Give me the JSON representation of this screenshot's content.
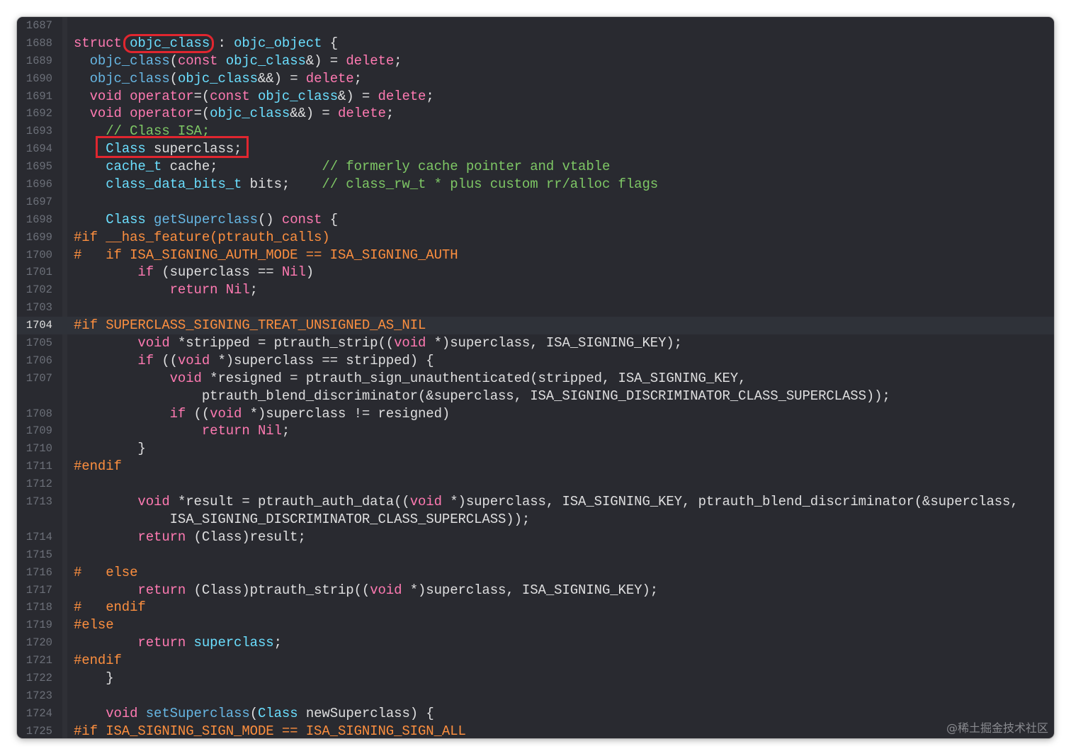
{
  "editor": {
    "lines": [
      {
        "n": "1687",
        "t": []
      },
      {
        "n": "1688",
        "t": [
          [
            "kw",
            "struct"
          ],
          [
            "id",
            " "
          ],
          [
            "type",
            "objc_class"
          ],
          [
            "id",
            " : "
          ],
          [
            "type",
            "objc_object"
          ],
          [
            "id",
            " {"
          ]
        ]
      },
      {
        "n": "1689",
        "t": [
          [
            "id",
            "  "
          ],
          [
            "fn",
            "objc_class"
          ],
          [
            "id",
            "("
          ],
          [
            "kw",
            "const"
          ],
          [
            "id",
            " "
          ],
          [
            "type",
            "objc_class"
          ],
          [
            "id",
            "&) = "
          ],
          [
            "kw",
            "delete"
          ],
          [
            "id",
            ";"
          ]
        ]
      },
      {
        "n": "1690",
        "t": [
          [
            "id",
            "  "
          ],
          [
            "fn",
            "objc_class"
          ],
          [
            "id",
            "("
          ],
          [
            "type",
            "objc_class"
          ],
          [
            "id",
            "&&) = "
          ],
          [
            "kw",
            "delete"
          ],
          [
            "id",
            ";"
          ]
        ]
      },
      {
        "n": "1691",
        "t": [
          [
            "id",
            "  "
          ],
          [
            "kw",
            "void"
          ],
          [
            "id",
            " "
          ],
          [
            "kw",
            "operator"
          ],
          [
            "id",
            "=("
          ],
          [
            "kw",
            "const"
          ],
          [
            "id",
            " "
          ],
          [
            "type",
            "objc_class"
          ],
          [
            "id",
            "&) = "
          ],
          [
            "kw",
            "delete"
          ],
          [
            "id",
            ";"
          ]
        ]
      },
      {
        "n": "1692",
        "t": [
          [
            "id",
            "  "
          ],
          [
            "kw",
            "void"
          ],
          [
            "id",
            " "
          ],
          [
            "kw",
            "operator"
          ],
          [
            "id",
            "=("
          ],
          [
            "type",
            "objc_class"
          ],
          [
            "id",
            "&&) = "
          ],
          [
            "kw",
            "delete"
          ],
          [
            "id",
            ";"
          ]
        ]
      },
      {
        "n": "1693",
        "t": [
          [
            "id",
            "    "
          ],
          [
            "com",
            "// Class ISA;"
          ]
        ]
      },
      {
        "n": "1694",
        "t": [
          [
            "id",
            "    "
          ],
          [
            "type",
            "Class"
          ],
          [
            "id",
            " superclass;"
          ]
        ]
      },
      {
        "n": "1695",
        "t": [
          [
            "id",
            "    "
          ],
          [
            "type",
            "cache_t"
          ],
          [
            "id",
            " cache;             "
          ],
          [
            "com",
            "// formerly cache pointer and vtable"
          ]
        ]
      },
      {
        "n": "1696",
        "t": [
          [
            "id",
            "    "
          ],
          [
            "type",
            "class_data_bits_t"
          ],
          [
            "id",
            " bits;    "
          ],
          [
            "com",
            "// class_rw_t * plus custom rr/alloc flags"
          ]
        ]
      },
      {
        "n": "1697",
        "t": []
      },
      {
        "n": "1698",
        "t": [
          [
            "id",
            "    "
          ],
          [
            "type",
            "Class"
          ],
          [
            "id",
            " "
          ],
          [
            "fn",
            "getSuperclass"
          ],
          [
            "id",
            "() "
          ],
          [
            "kw",
            "const"
          ],
          [
            "id",
            " {"
          ]
        ]
      },
      {
        "n": "1699",
        "t": [
          [
            "pre",
            "#if __has_feature(ptrauth_calls)"
          ]
        ]
      },
      {
        "n": "1700",
        "t": [
          [
            "pre",
            "#   if ISA_SIGNING_AUTH_MODE == ISA_SIGNING_AUTH"
          ]
        ]
      },
      {
        "n": "1701",
        "t": [
          [
            "id",
            "        "
          ],
          [
            "kw",
            "if"
          ],
          [
            "id",
            " (superclass == "
          ],
          [
            "kw",
            "Nil"
          ],
          [
            "id",
            ")"
          ]
        ]
      },
      {
        "n": "1702",
        "t": [
          [
            "id",
            "            "
          ],
          [
            "kw",
            "return"
          ],
          [
            "id",
            " "
          ],
          [
            "kw",
            "Nil"
          ],
          [
            "id",
            ";"
          ]
        ]
      },
      {
        "n": "1703",
        "t": []
      },
      {
        "n": "1704",
        "current": true,
        "t": [
          [
            "pre",
            "#if SUPERCLASS_SIGNING_TREAT_UNSIGNED_AS_NIL"
          ]
        ]
      },
      {
        "n": "1705",
        "t": [
          [
            "id",
            "        "
          ],
          [
            "kw",
            "void"
          ],
          [
            "id",
            " *stripped = ptrauth_strip(("
          ],
          [
            "kw",
            "void"
          ],
          [
            "id",
            " *)superclass, ISA_SIGNING_KEY);"
          ]
        ]
      },
      {
        "n": "1706",
        "t": [
          [
            "id",
            "        "
          ],
          [
            "kw",
            "if"
          ],
          [
            "id",
            " (("
          ],
          [
            "kw",
            "void"
          ],
          [
            "id",
            " *)superclass == stripped) {"
          ]
        ]
      },
      {
        "n": "1707",
        "t": [
          [
            "id",
            "            "
          ],
          [
            "kw",
            "void"
          ],
          [
            "id",
            " *resigned = ptrauth_sign_unauthenticated(stripped, ISA_SIGNING_KEY,"
          ]
        ]
      },
      {
        "n": "",
        "t": [
          [
            "id",
            "                ptrauth_blend_discriminator(&superclass, ISA_SIGNING_DISCRIMINATOR_CLASS_SUPERCLASS));"
          ]
        ]
      },
      {
        "n": "1708",
        "t": [
          [
            "id",
            "            "
          ],
          [
            "kw",
            "if"
          ],
          [
            "id",
            " (("
          ],
          [
            "kw",
            "void"
          ],
          [
            "id",
            " *)superclass != resigned)"
          ]
        ]
      },
      {
        "n": "1709",
        "t": [
          [
            "id",
            "                "
          ],
          [
            "kw",
            "return"
          ],
          [
            "id",
            " "
          ],
          [
            "kw",
            "Nil"
          ],
          [
            "id",
            ";"
          ]
        ]
      },
      {
        "n": "1710",
        "t": [
          [
            "id",
            "        }"
          ]
        ]
      },
      {
        "n": "1711",
        "t": [
          [
            "pre",
            "#endif"
          ]
        ]
      },
      {
        "n": "1712",
        "t": []
      },
      {
        "n": "1713",
        "t": [
          [
            "id",
            "        "
          ],
          [
            "kw",
            "void"
          ],
          [
            "id",
            " *result = ptrauth_auth_data(("
          ],
          [
            "kw",
            "void"
          ],
          [
            "id",
            " *)superclass, ISA_SIGNING_KEY, ptrauth_blend_discriminator(&superclass,"
          ]
        ]
      },
      {
        "n": "",
        "t": [
          [
            "id",
            "            ISA_SIGNING_DISCRIMINATOR_CLASS_SUPERCLASS));"
          ]
        ]
      },
      {
        "n": "1714",
        "t": [
          [
            "id",
            "        "
          ],
          [
            "kw",
            "return"
          ],
          [
            "id",
            " (Class)result;"
          ]
        ]
      },
      {
        "n": "1715",
        "t": []
      },
      {
        "n": "1716",
        "t": [
          [
            "pre",
            "#   else"
          ]
        ]
      },
      {
        "n": "1717",
        "t": [
          [
            "id",
            "        "
          ],
          [
            "kw",
            "return"
          ],
          [
            "id",
            " (Class)ptrauth_strip(("
          ],
          [
            "kw",
            "void"
          ],
          [
            "id",
            " *)superclass, ISA_SIGNING_KEY);"
          ]
        ]
      },
      {
        "n": "1718",
        "t": [
          [
            "pre",
            "#   endif"
          ]
        ]
      },
      {
        "n": "1719",
        "t": [
          [
            "pre",
            "#else"
          ]
        ]
      },
      {
        "n": "1720",
        "t": [
          [
            "id",
            "        "
          ],
          [
            "kw",
            "return"
          ],
          [
            "id",
            " "
          ],
          [
            "type",
            "superclass"
          ],
          [
            "id",
            ";"
          ]
        ]
      },
      {
        "n": "1721",
        "t": [
          [
            "pre",
            "#endif"
          ]
        ]
      },
      {
        "n": "1722",
        "t": [
          [
            "id",
            "    }"
          ]
        ]
      },
      {
        "n": "1723",
        "t": []
      },
      {
        "n": "1724",
        "t": [
          [
            "id",
            "    "
          ],
          [
            "kw",
            "void"
          ],
          [
            "id",
            " "
          ],
          [
            "fn",
            "setSuperclass"
          ],
          [
            "id",
            "("
          ],
          [
            "type",
            "Class"
          ],
          [
            "id",
            " newSuperclass) {"
          ]
        ]
      },
      {
        "n": "1725",
        "t": [
          [
            "pre",
            "#if ISA_SIGNING_SIGN_MODE == ISA_SIGNING_SIGN_ALL"
          ]
        ]
      }
    ]
  },
  "colors": {
    "background": "#292a30",
    "keyword": "#ff7ab2",
    "type": "#6bdfff",
    "function": "#67b7e4",
    "comment": "#7ec765",
    "preprocessor": "#fd8f3f",
    "plain": "#dfdfe0",
    "annotation": "#e0262f"
  },
  "watermark": "@稀土掘金技术社区"
}
